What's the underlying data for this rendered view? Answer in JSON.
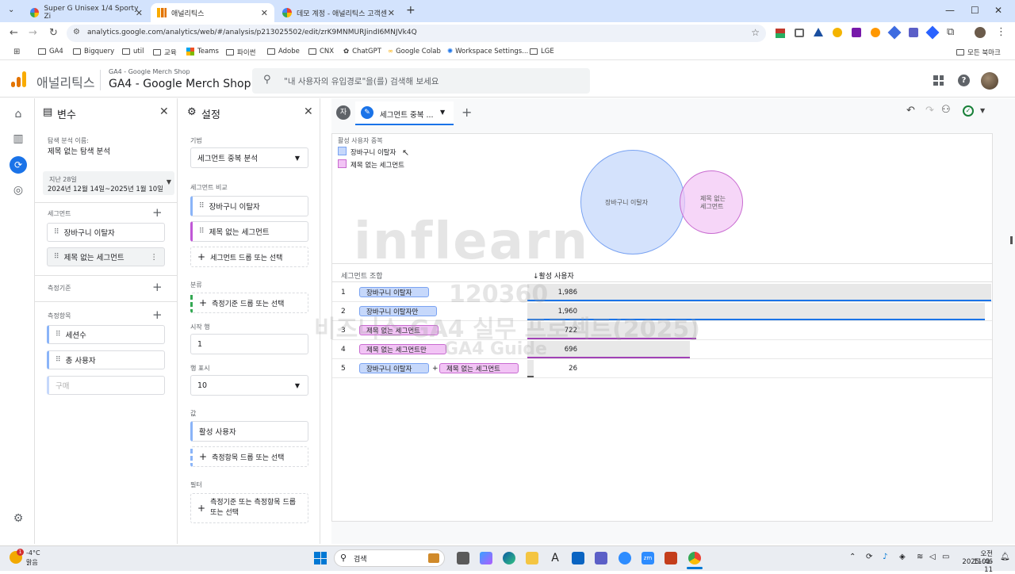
{
  "browser": {
    "tabs": [
      {
        "title": "Super G Unisex 1/4 Sporty Zi"
      },
      {
        "title": "애널리틱스"
      },
      {
        "title": "데모 계정 - 애널리틱스 고객센"
      }
    ],
    "url": "analytics.google.com/analytics/web/#/analysis/p213025502/edit/zrK9MNMURJindI6MNJVk4Q",
    "bookmarks": [
      "GA4",
      "Bigquery",
      "util",
      "교육",
      "Teams",
      "파이썬",
      "Adobe",
      "CNX",
      "ChatGPT",
      "Google Colab",
      "Workspace Settings...",
      "LGE"
    ],
    "all_bookmarks": "모든 북마크"
  },
  "ga": {
    "product": "애널리틱스",
    "property_parent": "GA4 - Google Merch Shop",
    "property": "GA4 - Google Merch Shop",
    "search_placeholder": "\"내 사용자의 유입경로\"을(를) 검색해 보세요"
  },
  "variables": {
    "title": "변수",
    "name_label": "탐색 분석 이름:",
    "name_value": "제목 없는 탐색 분석",
    "date_label": "지난 28일",
    "date_range": "2024년 12월 14일~2025년 1월 10일",
    "segments_label": "세그먼트",
    "segments": [
      "장바구니 이탈자",
      "제목 없는 세그먼트"
    ],
    "dimensions_label": "측정기준",
    "metrics_label": "측정항목",
    "metrics": [
      "세션수",
      "총 사용자"
    ],
    "metric_placeholder": "구매"
  },
  "settings": {
    "title": "설정",
    "technique_label": "기법",
    "technique_value": "세그먼트 중복 분석",
    "compare_label": "세그먼트 비교",
    "compare_segments": [
      "장바구니 이탈자",
      "제목 없는 세그먼트"
    ],
    "compare_drop": "세그먼트 드롭 또는 선택",
    "breakdown_label": "분류",
    "breakdown_drop": "측정기준 드롭 또는 선택",
    "start_row_label": "시작 행",
    "start_row_value": "1",
    "show_rows_label": "행 표시",
    "show_rows_value": "10",
    "values_label": "값",
    "values_metric": "활성 사용자",
    "values_drop": "측정항목 드롭 또는 선택",
    "filters_label": "필터",
    "filters_drop": "측정기준 또는 측정항목 드롭 또는 선택"
  },
  "canvas": {
    "avatar_letter": "자",
    "tab_title": "세그먼트 중복 ...",
    "venn_title": "활성 사용자 중복",
    "legend": [
      "장바구니 이탈자",
      "제목 없는 세그먼트"
    ],
    "venn_labels": [
      "장바구니 이탈자",
      "제목 없는",
      "세그먼트"
    ],
    "col_segment": "세그먼트 조합",
    "col_metric": "↓활성 사용자",
    "rows": [
      {
        "num": "1",
        "a": "장바구니 이탈자",
        "plus": "",
        "b": "",
        "value": "1,986"
      },
      {
        "num": "2",
        "a": "장바구니 이탈자만",
        "plus": "",
        "b": "",
        "value": "1,960"
      },
      {
        "num": "3",
        "a": "제목 없는 세그먼트",
        "plus": "",
        "b": "",
        "value": "722"
      },
      {
        "num": "4",
        "a": "제목 없는 세그먼트만",
        "plus": "",
        "b": "",
        "value": "696"
      },
      {
        "num": "5",
        "a": "장바구니 이탈자",
        "plus": "+",
        "b": "제목 없는 세그먼트",
        "value": "26"
      }
    ],
    "bar_fractions": [
      1.0,
      0.987,
      0.364,
      0.35,
      0.013
    ]
  },
  "watermark": {
    "brand": "inflearn",
    "id": "120360",
    "line1": "비즈니스 GA4 실무 프로젝트(2025)",
    "line2": "GA4 Guide"
  },
  "taskbar": {
    "weather_temp": "-4°C",
    "weather_text": "맑음",
    "search": "검색",
    "time": "오전 11:46",
    "date": "2025-01-11"
  },
  "colors": {
    "blue": "#8ab4f8",
    "purple": "#c058d6",
    "accent": "#1a73e8"
  }
}
